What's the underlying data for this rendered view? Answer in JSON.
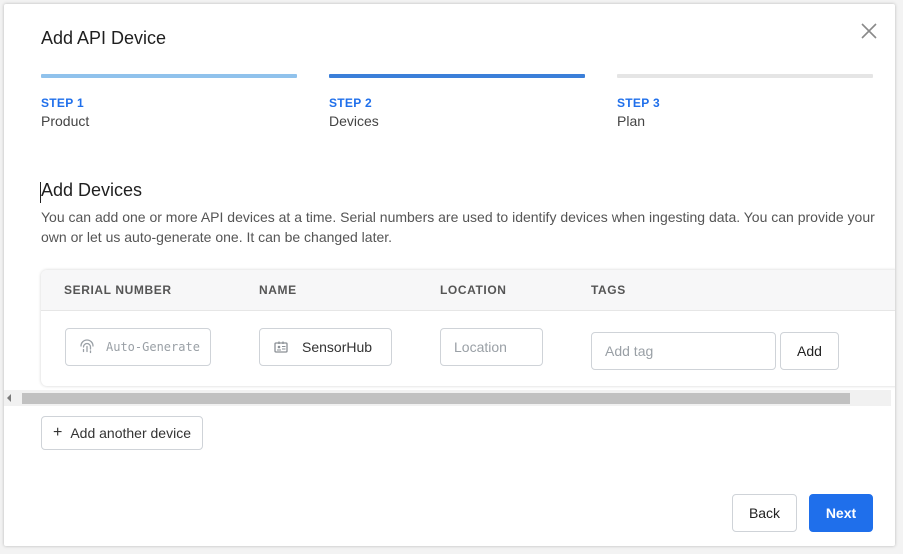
{
  "dialog": {
    "title": "Add API Device",
    "close_icon": "close-icon"
  },
  "steps": [
    {
      "number": "STEP 1",
      "label": "Product",
      "state": "completed",
      "bar_color": "#90c2ec",
      "num_color": "#1f6feb"
    },
    {
      "number": "STEP 2",
      "label": "Devices",
      "state": "active",
      "bar_color": "#3b7fd9",
      "num_color": "#1f6feb"
    },
    {
      "number": "STEP 3",
      "label": "Plan",
      "state": "upcoming",
      "bar_color": "#e5e5e5",
      "num_color": "#1f6feb"
    }
  ],
  "section": {
    "title": "Add Devices",
    "description": "You can add one or more API devices at a time. Serial numbers are used to identify devices when ingesting data. You can provide your own or let us auto-generate one. It can be changed later."
  },
  "table": {
    "columns": [
      "SERIAL NUMBER",
      "NAME",
      "LOCATION",
      "TAGS"
    ],
    "row": {
      "serial_placeholder": "Auto-Generate",
      "serial_value": "",
      "name_value": "SensorHub",
      "location_placeholder": "Location",
      "location_value": "",
      "tag_placeholder": "Add tag",
      "add_tag_label": "Add"
    }
  },
  "add_another_label": "Add another device",
  "footer": {
    "back_label": "Back",
    "next_label": "Next"
  },
  "colors": {
    "primary": "#1f6feb",
    "border": "#cfd3d8"
  }
}
